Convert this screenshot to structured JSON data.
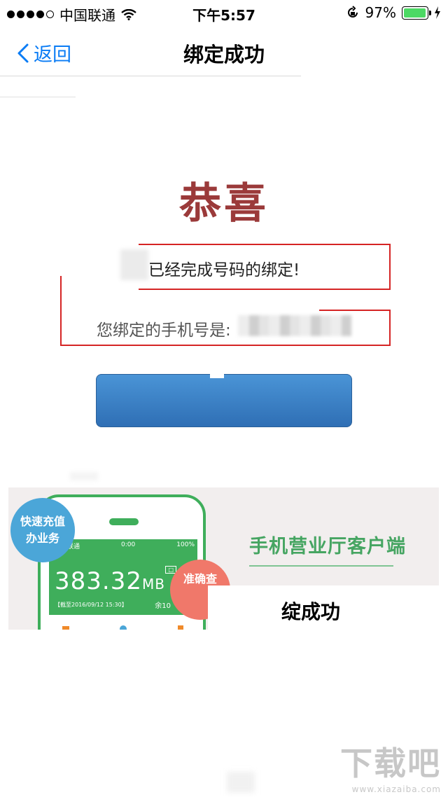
{
  "status_bar": {
    "carrier": "中国联通",
    "time": "下午5:57",
    "battery_percent": "97%",
    "battery_level": 0.97,
    "signal_bars_filled": 4,
    "signal_bars_total": 5
  },
  "nav": {
    "back_label": "返回",
    "title": "绑定成功"
  },
  "content": {
    "congrats": "恭喜",
    "message_completed": "已经完成号码的绑定!",
    "phone_label": "您绑定的手机号是:",
    "button_label": ""
  },
  "banner": {
    "badge_left": "快速充值办业务",
    "badge_right": "准确查",
    "title": "手机营业厅客户端",
    "phone_status_carrier": "中国联通",
    "phone_status_time": "0:00",
    "phone_status_battery": "100%",
    "phone_usage_value": "383.32",
    "phone_usage_unit": "MB",
    "phone_date": "【截至2016/09/12 15:30】",
    "phone_remaining": "余10",
    "tail_text": "绽成功"
  },
  "watermark": {
    "text": "下载吧",
    "url": "www.xiazaiba.com"
  },
  "colors": {
    "ios_blue": "#0a7cf5",
    "congrats_red": "#9b3a3a",
    "highlight_red": "#d52424",
    "button_blue": "#3a82c6",
    "banner_green": "#3fae5b",
    "badge_blue": "#4ba6d8",
    "badge_pink": "#f0786a"
  }
}
